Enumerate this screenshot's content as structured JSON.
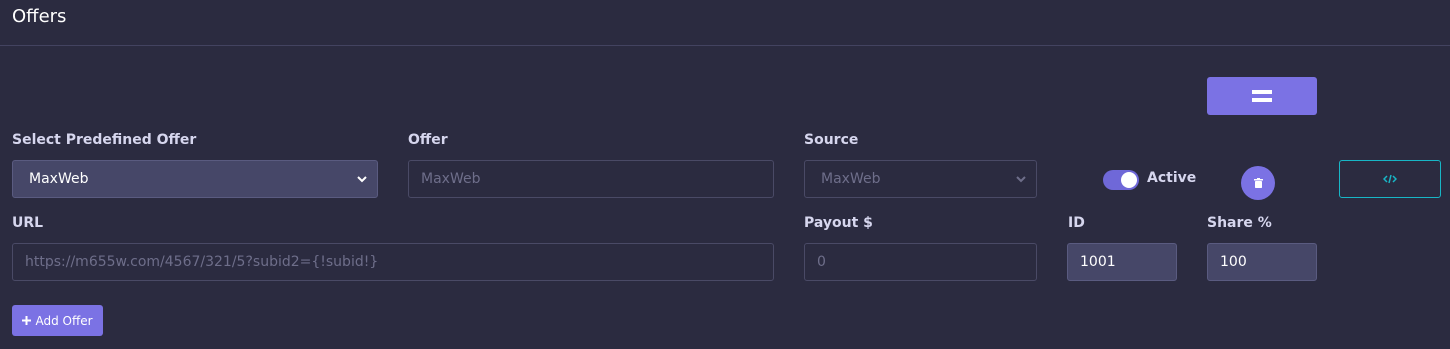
{
  "header": {
    "title": "Offers"
  },
  "form": {
    "predefined": {
      "label": "Select Predefined Offer",
      "value": "MaxWeb"
    },
    "offer": {
      "label": "Offer",
      "placeholder": "MaxWeb"
    },
    "source": {
      "label": "Source",
      "value": "MaxWeb"
    },
    "active": {
      "label": "Active",
      "on": true
    },
    "url": {
      "label": "URL",
      "placeholder": "https://m655w.com/4567/321/5?subid2={!subid!}"
    },
    "payout": {
      "label": "Payout $",
      "placeholder": "0"
    },
    "id": {
      "label": "ID",
      "value": "1001"
    },
    "share": {
      "label": "Share %",
      "value": "100"
    }
  },
  "actions": {
    "add_offer": "Add Offer"
  },
  "icons": {
    "drag": "drag-handle-icon",
    "delete": "trash-icon",
    "code": "code-icon",
    "add": "plus-icon"
  },
  "colors": {
    "accent": "#7b72e4",
    "code_border": "#18b6c6",
    "background": "#2b2b40"
  }
}
